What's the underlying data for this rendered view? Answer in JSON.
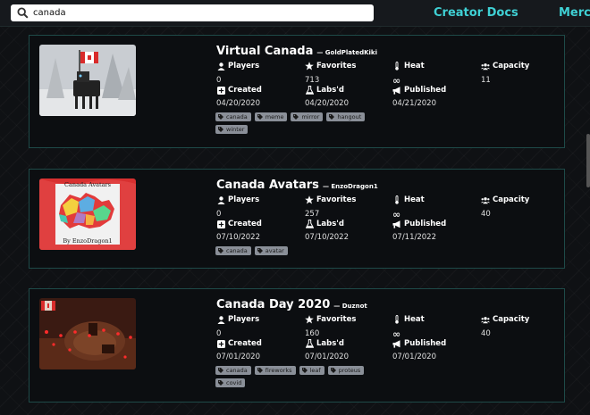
{
  "search": {
    "value": "canada",
    "placeholder": ""
  },
  "nav": {
    "creator_docs": "Creator Docs",
    "merch": "Merch"
  },
  "stat_labels": {
    "players": "Players",
    "favorites": "Favorites",
    "heat": "Heat",
    "capacity": "Capacity",
    "created": "Created",
    "labsd": "Labs'd",
    "published": "Published"
  },
  "cards": [
    {
      "title": "Virtual Canada",
      "author": "— GoldPlatedKiki",
      "players": "0",
      "favorites": "713",
      "heat": "∞",
      "capacity": "11",
      "created": "04/20/2020",
      "labsd": "04/20/2020",
      "published": "04/21/2020",
      "tags": [
        "canada",
        "meme",
        "mirror",
        "hangout",
        "winter"
      ]
    },
    {
      "title": "Canada Avatars",
      "author": "— EnzoDragon1",
      "thumb_text_top": "Canada Avatars",
      "thumb_text_bottom": "By EnzoDragon1",
      "players": "0",
      "favorites": "257",
      "heat": "∞",
      "capacity": "40",
      "created": "07/10/2022",
      "labsd": "07/10/2022",
      "published": "07/11/2022",
      "tags": [
        "canada",
        "avatar"
      ]
    },
    {
      "title": "Canada Day 2020",
      "author": "— Duznot",
      "players": "0",
      "favorites": "160",
      "heat": "∞",
      "capacity": "40",
      "created": "07/01/2020",
      "labsd": "07/01/2020",
      "published": "07/01/2020",
      "tags": [
        "canada",
        "fireworks",
        "leaf",
        "proteus",
        "covid"
      ]
    }
  ],
  "colors": {
    "accent": "#3fd0d4",
    "card_border": "#1e4a48",
    "tag_bg": "#8a8f98"
  }
}
